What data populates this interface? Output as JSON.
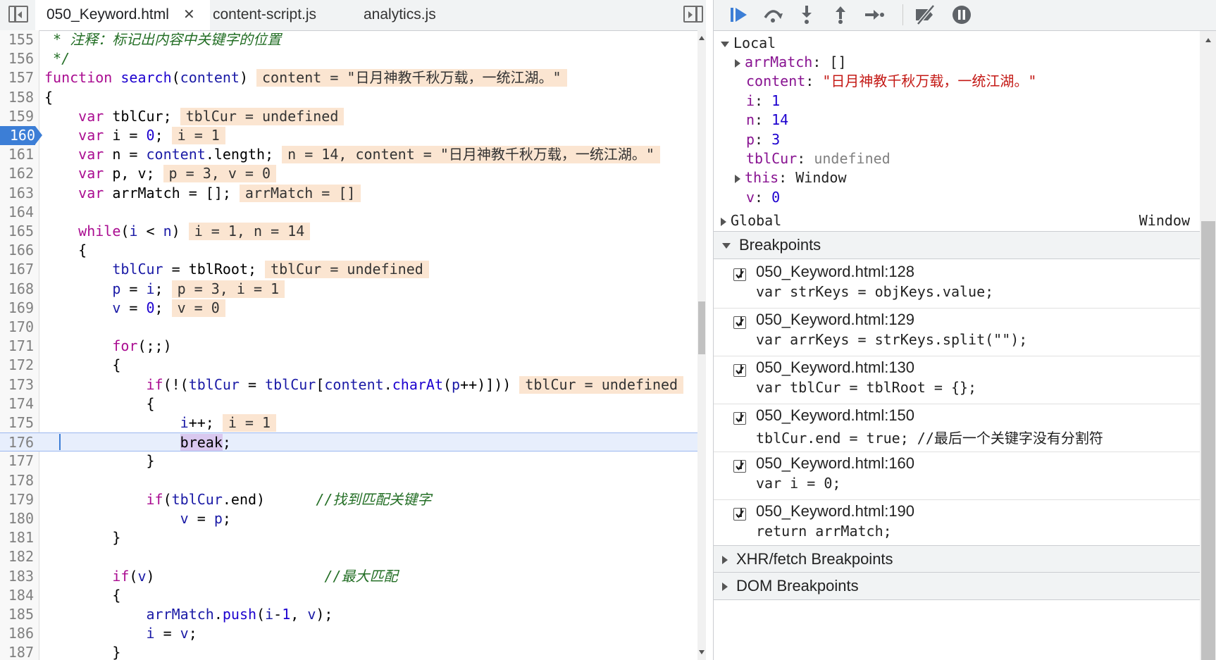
{
  "tabs": [
    {
      "label": "050_Keyword.html",
      "active": true,
      "close": "✕"
    },
    {
      "label": "content-script.js",
      "active": false
    },
    {
      "label": "analytics.js",
      "active": false
    }
  ],
  "code_lines": [
    {
      "n": "155",
      "parts": [
        [
          "cmt",
          " * 注释：标记出内容中关键字的位置"
        ]
      ]
    },
    {
      "n": "156",
      "parts": [
        [
          "cmt",
          " */"
        ]
      ]
    },
    {
      "n": "157",
      "parts": [
        [
          "kw",
          "function"
        ],
        [
          "",
          " "
        ],
        [
          "fn",
          "search"
        ],
        [
          "",
          "("
        ],
        [
          "var",
          "content"
        ],
        [
          "",
          ")"
        ],
        [
          "inl",
          "content = \"日月神教千秋万载，一统江湖。\""
        ]
      ]
    },
    {
      "n": "158",
      "parts": [
        [
          "",
          "{"
        ]
      ]
    },
    {
      "n": "159",
      "parts": [
        [
          "",
          "    "
        ],
        [
          "kw",
          "var"
        ],
        [
          "",
          " tblCur;"
        ],
        [
          "inl",
          "tblCur = undefined"
        ]
      ]
    },
    {
      "n": "160",
      "bp": true,
      "parts": [
        [
          "",
          "    "
        ],
        [
          "kw",
          "var"
        ],
        [
          "",
          " i = "
        ],
        [
          "num",
          "0"
        ],
        [
          "",
          ";"
        ],
        [
          "inl",
          "i = 1"
        ]
      ]
    },
    {
      "n": "161",
      "parts": [
        [
          "",
          "    "
        ],
        [
          "kw",
          "var"
        ],
        [
          "",
          " n = "
        ],
        [
          "var",
          "content"
        ],
        [
          "",
          ".length;"
        ],
        [
          "inl",
          "n = 14, content = \"日月神教千秋万载，一统江湖。\""
        ]
      ]
    },
    {
      "n": "162",
      "parts": [
        [
          "",
          "    "
        ],
        [
          "kw",
          "var"
        ],
        [
          "",
          " p, v;"
        ],
        [
          "inl",
          "p = 3, v = 0"
        ]
      ]
    },
    {
      "n": "163",
      "parts": [
        [
          "",
          "    "
        ],
        [
          "kw",
          "var"
        ],
        [
          "",
          " arrMatch = [];"
        ],
        [
          "inl",
          "arrMatch = []"
        ]
      ]
    },
    {
      "n": "164",
      "parts": []
    },
    {
      "n": "165",
      "parts": [
        [
          "",
          "    "
        ],
        [
          "kw",
          "while"
        ],
        [
          "",
          "("
        ],
        [
          "var",
          "i"
        ],
        [
          "",
          " < "
        ],
        [
          "var",
          "n"
        ],
        [
          "",
          ")"
        ],
        [
          "inl",
          "i = 1, n = 14"
        ]
      ]
    },
    {
      "n": "166",
      "parts": [
        [
          "",
          "    {"
        ]
      ]
    },
    {
      "n": "167",
      "parts": [
        [
          "",
          "        "
        ],
        [
          "var",
          "tblCur"
        ],
        [
          "",
          " = tblRoot;"
        ],
        [
          "inl",
          "tblCur = undefined"
        ]
      ]
    },
    {
      "n": "168",
      "parts": [
        [
          "",
          "        "
        ],
        [
          "var",
          "p"
        ],
        [
          "",
          " = "
        ],
        [
          "var",
          "i"
        ],
        [
          "",
          ";"
        ],
        [
          "inl",
          "p = 3, i = 1"
        ]
      ]
    },
    {
      "n": "169",
      "parts": [
        [
          "",
          "        "
        ],
        [
          "var",
          "v"
        ],
        [
          "",
          " = "
        ],
        [
          "num",
          "0"
        ],
        [
          "",
          ";"
        ],
        [
          "inl",
          "v = 0"
        ]
      ]
    },
    {
      "n": "170",
      "parts": []
    },
    {
      "n": "171",
      "parts": [
        [
          "",
          "        "
        ],
        [
          "kw",
          "for"
        ],
        [
          "",
          "(;;)"
        ]
      ]
    },
    {
      "n": "172",
      "parts": [
        [
          "",
          "        {"
        ]
      ]
    },
    {
      "n": "173",
      "parts": [
        [
          "",
          "            "
        ],
        [
          "kw",
          "if"
        ],
        [
          "",
          "(!("
        ],
        [
          "var",
          "tblCur"
        ],
        [
          "",
          " = "
        ],
        [
          "var",
          "tblCur"
        ],
        [
          "",
          "["
        ],
        [
          "var",
          "content"
        ],
        [
          "",
          "."
        ],
        [
          "fn",
          "charAt"
        ],
        [
          "",
          "("
        ],
        [
          "var",
          "p"
        ],
        [
          "",
          "++)]))"
        ],
        [
          "inl",
          "tblCur = undefined"
        ]
      ]
    },
    {
      "n": "174",
      "parts": [
        [
          "",
          "            {"
        ]
      ]
    },
    {
      "n": "175",
      "parts": [
        [
          "",
          "                "
        ],
        [
          "var",
          "i"
        ],
        [
          "",
          "++;"
        ],
        [
          "inl",
          "i = 1"
        ]
      ]
    },
    {
      "n": "176",
      "current": true,
      "parts": [
        [
          "",
          "                "
        ],
        [
          "hl",
          "break"
        ],
        [
          "",
          ";"
        ]
      ]
    },
    {
      "n": "177",
      "parts": [
        [
          "",
          "            }"
        ]
      ]
    },
    {
      "n": "178",
      "parts": []
    },
    {
      "n": "179",
      "parts": [
        [
          "",
          "            "
        ],
        [
          "kw",
          "if"
        ],
        [
          "",
          "("
        ],
        [
          "var",
          "tblCur"
        ],
        [
          "",
          ".end)      "
        ],
        [
          "cmt",
          "//找到匹配关键字"
        ]
      ]
    },
    {
      "n": "180",
      "parts": [
        [
          "",
          "                "
        ],
        [
          "var",
          "v"
        ],
        [
          "",
          " = "
        ],
        [
          "var",
          "p"
        ],
        [
          "",
          ";"
        ]
      ]
    },
    {
      "n": "181",
      "parts": [
        [
          "",
          "        }"
        ]
      ]
    },
    {
      "n": "182",
      "parts": []
    },
    {
      "n": "183",
      "parts": [
        [
          "",
          "        "
        ],
        [
          "kw",
          "if"
        ],
        [
          "",
          "("
        ],
        [
          "var",
          "v"
        ],
        [
          "",
          ")                    "
        ],
        [
          "cmt",
          "//最大匹配"
        ]
      ]
    },
    {
      "n": "184",
      "parts": [
        [
          "",
          "        {"
        ]
      ]
    },
    {
      "n": "185",
      "parts": [
        [
          "",
          "            "
        ],
        [
          "var",
          "arrMatch"
        ],
        [
          "",
          "."
        ],
        [
          "fn",
          "push"
        ],
        [
          "",
          "("
        ],
        [
          "var",
          "i"
        ],
        [
          "",
          "-"
        ],
        [
          "num",
          "1"
        ],
        [
          "",
          ", "
        ],
        [
          "var",
          "v"
        ],
        [
          "",
          ");"
        ]
      ]
    },
    {
      "n": "186",
      "parts": [
        [
          "",
          "            "
        ],
        [
          "var",
          "i"
        ],
        [
          "",
          " = "
        ],
        [
          "var",
          "v"
        ],
        [
          "",
          ";"
        ]
      ]
    },
    {
      "n": "187",
      "parts": [
        [
          "",
          "        }"
        ]
      ]
    }
  ],
  "scope": {
    "local_label": "Local",
    "vars": [
      {
        "name": "arrMatch",
        "value": "[]",
        "type": "plain",
        "expandable": true
      },
      {
        "name": "content",
        "value": "\"日月神教千秋万载，一统江湖。\"",
        "type": "string",
        "expandable": false
      },
      {
        "name": "i",
        "value": "1",
        "type": "number",
        "expandable": false
      },
      {
        "name": "n",
        "value": "14",
        "type": "number",
        "expandable": false
      },
      {
        "name": "p",
        "value": "3",
        "type": "number",
        "expandable": false
      },
      {
        "name": "tblCur",
        "value": "undefined",
        "type": "undefined",
        "expandable": false
      },
      {
        "name": "this",
        "value": "Window",
        "type": "plain",
        "expandable": true
      },
      {
        "name": "v",
        "value": "0",
        "type": "number",
        "expandable": false
      }
    ],
    "global_label": "Global",
    "global_value": "Window"
  },
  "breakpoints": {
    "label": "Breakpoints",
    "items": [
      {
        "location": "050_Keyword.html:128",
        "code": "var strKeys = objKeys.value;"
      },
      {
        "location": "050_Keyword.html:129",
        "code": "var arrKeys = strKeys.split(\"\");"
      },
      {
        "location": "050_Keyword.html:130",
        "code": "var tblCur = tblRoot = {};"
      },
      {
        "location": "050_Keyword.html:150",
        "code": "tblCur.end = true; //最后一个关键字没有分割符"
      },
      {
        "location": "050_Keyword.html:160",
        "code": "var i = 0;"
      },
      {
        "location": "050_Keyword.html:190",
        "code": "return arrMatch;"
      }
    ]
  },
  "xhr_label": "XHR/fetch Breakpoints",
  "dom_label": "DOM Breakpoints",
  "colors": {
    "accent": "#3c7ed6",
    "inline_value_bg": "#fbe5d1"
  }
}
